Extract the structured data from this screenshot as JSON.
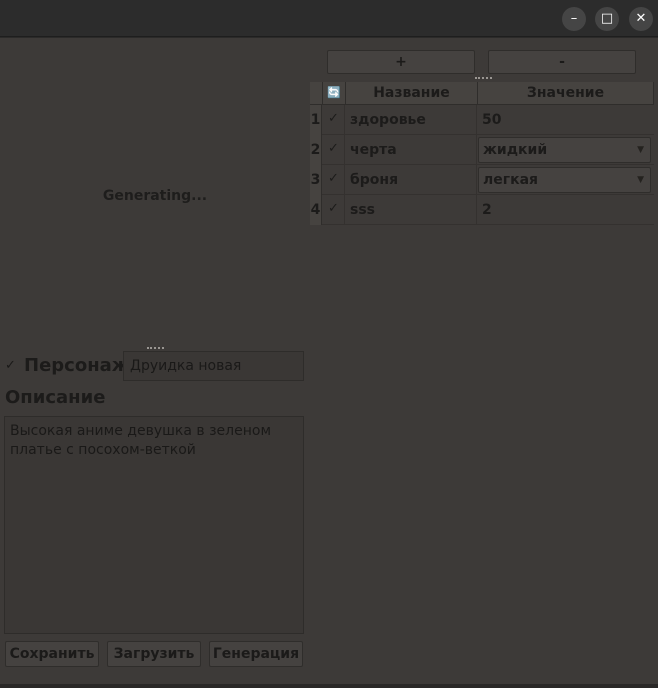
{
  "window": {
    "minimize_glyph": "–",
    "maximize_glyph": "□",
    "close_glyph": "✕"
  },
  "left": {
    "status_text": "Generating...",
    "character_label": "Персонаж",
    "character_checkbox": "✓",
    "character_name": "Друидка новая",
    "description_label": "Описание",
    "description_text": "Высокая аниме девушка в зеленом платье с посохом-веткой",
    "buttons": {
      "save": "Сохранить",
      "load": "Загрузить",
      "generate": "Генерация"
    }
  },
  "right": {
    "add_button": "+",
    "remove_button": "-",
    "table": {
      "refresh_icon": "🔄",
      "columns": [
        "Название",
        "Значение"
      ],
      "rows": [
        {
          "num": "1",
          "check": "✓",
          "name": "здоровье",
          "value": "50"
        },
        {
          "num": "2",
          "check": "✓",
          "name": "черта",
          "value": "жидкий"
        },
        {
          "num": "3",
          "check": "✓",
          "name": "броня",
          "value": "легкая"
        },
        {
          "num": "4",
          "check": "✓",
          "name": "sss",
          "value": "2"
        }
      ]
    }
  }
}
